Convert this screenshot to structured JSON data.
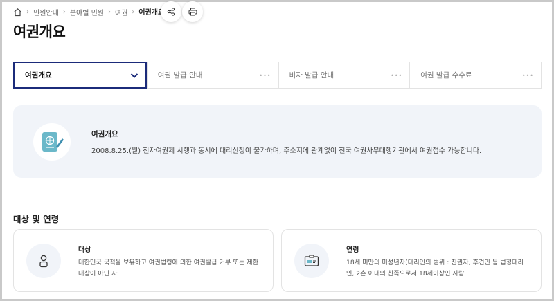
{
  "breadcrumb": {
    "items": [
      "민원안내",
      "분야별 민원",
      "여권"
    ],
    "current": "여권개요"
  },
  "page_title": "여권개요",
  "tabs": [
    {
      "label": "여권개요",
      "active": true
    },
    {
      "label": "여권 발급 안내",
      "active": false
    },
    {
      "label": "비자 발급 안내",
      "active": false
    },
    {
      "label": "여권 발급 수수료",
      "active": false
    }
  ],
  "info": {
    "title": "여권개요",
    "description": "2008.8.25.(월) 전자여권제 시행과 동시에 대리신청이 불가하며, 주소지에 관계없이 전국 여권사무대행기관에서 여권접수 가능합니다."
  },
  "section": {
    "title": "대상 및 연령"
  },
  "cards": [
    {
      "title": "대상",
      "description": "대한민국 국적을 보유하고 여권법령에 의한 여권발급 거부 또는 제한 대상이 아닌 자",
      "icon": "person-icon"
    },
    {
      "title": "연령",
      "description": "18세 미만의 미성년자(대리인의 범위 : 친권자, 후견인 등 법정대리인, 2촌 이내의 친족으로서 18세이상인 사람",
      "icon": "id-card-icon"
    }
  ],
  "colors": {
    "accent": "#1b2b7a",
    "panel_bg": "#f1f4f9",
    "passport_icon": "#6bb8c9"
  }
}
